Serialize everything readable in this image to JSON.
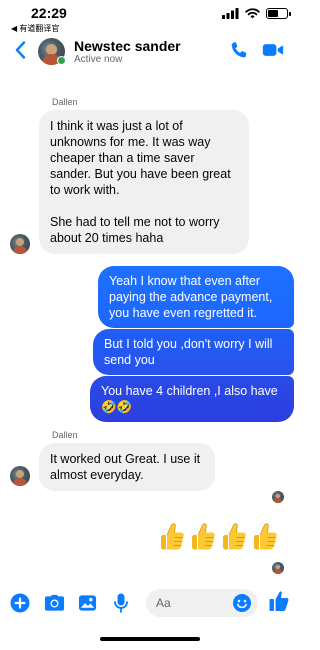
{
  "status_bar": {
    "time": "22:29",
    "back_app": "◀ 有道翻译官",
    "battery_level": 0.55
  },
  "header": {
    "contact_name": "Newstec sander",
    "status": "Active now",
    "online": true
  },
  "messages": [
    {
      "direction": "in",
      "sender": "Dallen",
      "text": "I think it was just a lot of unknowns for me. It was way cheaper than a time saver sander. But you have been great to work with.\n\nShe had to tell me not to worry about 20 times haha"
    },
    {
      "direction": "out",
      "text": "Yeah I know that even after paying the advance payment, you have even regretted it."
    },
    {
      "direction": "out",
      "text": "But I told you ,don't worry I will send you"
    },
    {
      "direction": "out",
      "text": "You have 4 children ,I also have 🤣🤣"
    },
    {
      "direction": "in",
      "sender": "Dallen",
      "text": "It worked out Great. I use it almost everyday."
    },
    {
      "direction": "out",
      "type": "emoji",
      "count": 4,
      "icon": "thumbs-up-icon"
    }
  ],
  "composer": {
    "placeholder": "Aa"
  },
  "colors": {
    "messenger_blue": "#0a7cff",
    "bubble_gradient_top": "#1f66ff",
    "bubble_gradient_bottom": "#2a3fe0",
    "incoming_bubble": "#f0f0f0",
    "online_green": "#31a24c"
  },
  "icons": [
    "back-chevron-icon",
    "phone-icon",
    "video-camera-icon",
    "plus-icon",
    "camera-icon",
    "gallery-icon",
    "microphone-icon",
    "smiley-icon",
    "thumbs-up-icon",
    "signal-icon",
    "wifi-icon",
    "battery-icon"
  ]
}
